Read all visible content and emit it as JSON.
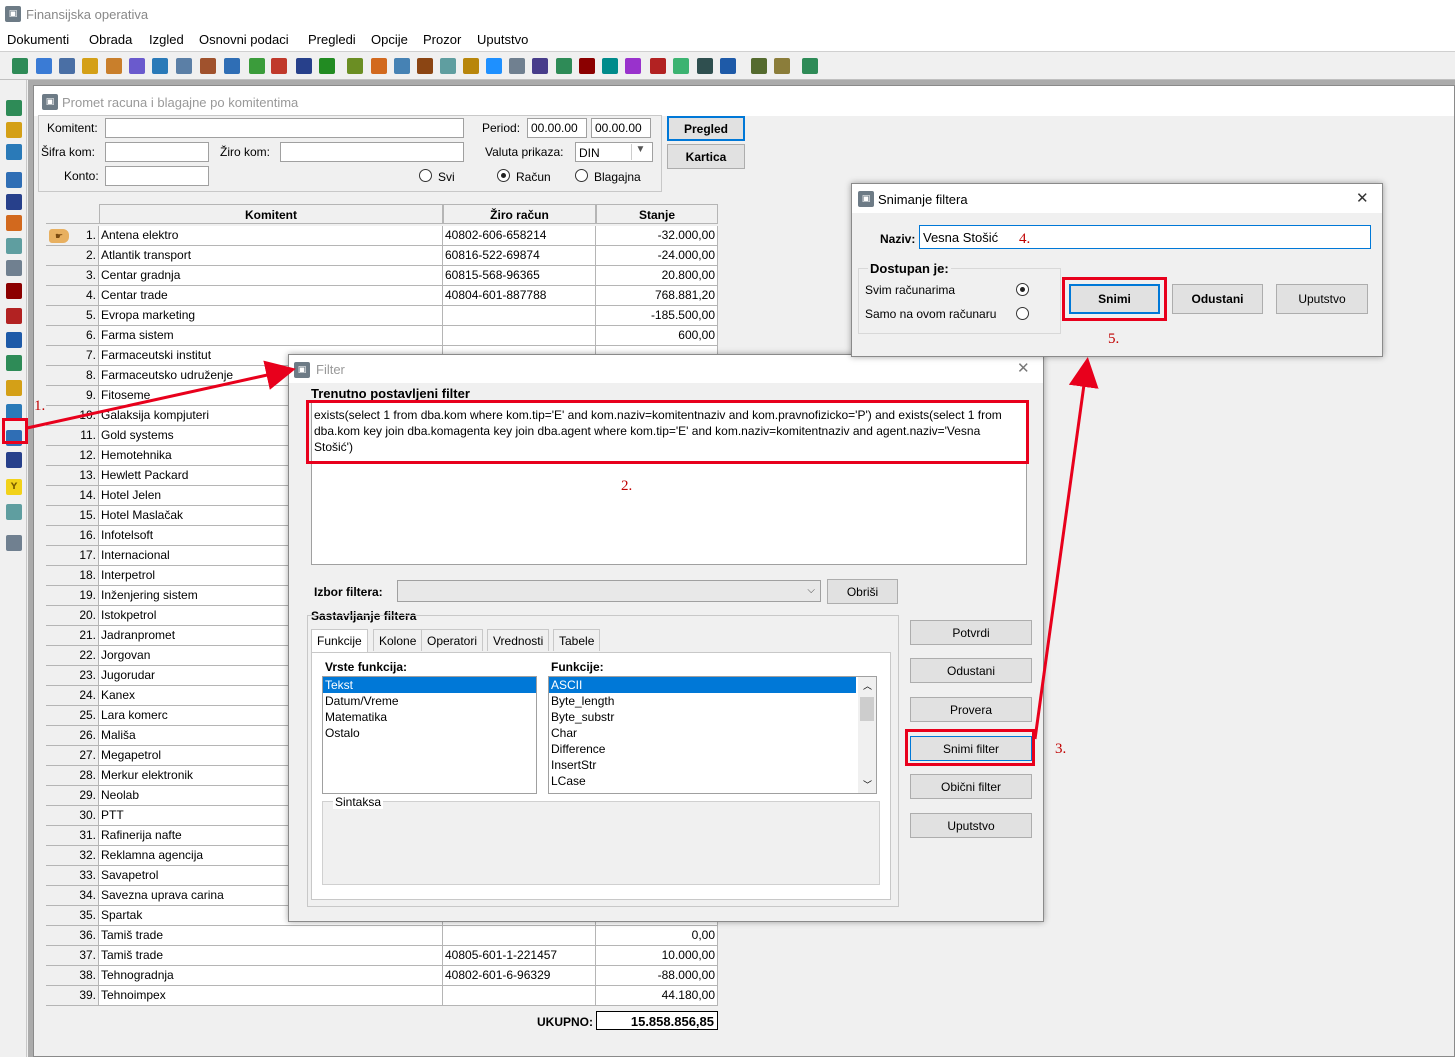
{
  "app": {
    "title": "Finansijska operativa"
  },
  "menu": [
    "Dokumenti",
    "Obrada",
    "Izgled",
    "Osnovni podaci",
    "Pregledi",
    "Opcije",
    "Prozor",
    "Uputstvo"
  ],
  "colors": {
    "annotation": "#e8001c",
    "selection": "#0078d7"
  },
  "child": {
    "title": "Promet racuna i blagajne po komitentima"
  },
  "form": {
    "komitent_label": "Komitent:",
    "sifra_label": "Šifra kom:",
    "ziro_label": "Žiro kom:",
    "konto_label": "Konto:",
    "period_label": "Period:",
    "period_from": "00.00.00",
    "period_to": "00.00.00",
    "valuta_label": "Valuta prikaza:",
    "valuta_value": "DIN",
    "radios": {
      "svi": "Svi",
      "racun": "Račun",
      "blagajna": "Blagajna"
    },
    "pregled": "Pregled",
    "kartica": "Kartica"
  },
  "grid": {
    "headers": [
      "Komitent",
      "Žiro račun",
      "Stanje"
    ],
    "rows": [
      [
        "1.",
        "Antena elektro",
        "40802-606-658214",
        "-32.000,00"
      ],
      [
        "2.",
        "Atlantik transport",
        "60816-522-69874",
        "-24.000,00"
      ],
      [
        "3.",
        "Centar gradnja",
        "60815-568-96365",
        "20.800,00"
      ],
      [
        "4.",
        "Centar trade",
        "40804-601-887788",
        "768.881,20"
      ],
      [
        "5.",
        "Evropa marketing",
        "",
        "-185.500,00"
      ],
      [
        "6.",
        "Farma sistem",
        "",
        "600,00"
      ],
      [
        "7.",
        "Farmaceutski institut",
        "",
        ""
      ],
      [
        "8.",
        "Farmaceutsko udruženje",
        "",
        ""
      ],
      [
        "9.",
        "Fitoseme",
        "",
        ""
      ],
      [
        "10.",
        "Galaksija kompjuteri",
        "",
        ""
      ],
      [
        "11.",
        "Gold systems",
        "",
        ""
      ],
      [
        "12.",
        "Hemotehnika",
        "",
        ""
      ],
      [
        "13.",
        "Hewlett Packard",
        "",
        ""
      ],
      [
        "14.",
        "Hotel Jelen",
        "",
        ""
      ],
      [
        "15.",
        "Hotel Maslačak",
        "",
        ""
      ],
      [
        "16.",
        "Infotelsoft",
        "",
        ""
      ],
      [
        "17.",
        "Internacional",
        "",
        ""
      ],
      [
        "18.",
        "Interpetrol",
        "",
        ""
      ],
      [
        "19.",
        "Inženjering sistem",
        "",
        ""
      ],
      [
        "20.",
        "Istokpetrol",
        "",
        ""
      ],
      [
        "21.",
        "Jadranpromet",
        "",
        ""
      ],
      [
        "22.",
        "Jorgovan",
        "",
        ""
      ],
      [
        "23.",
        "Jugorudar",
        "",
        ""
      ],
      [
        "24.",
        "Kanex",
        "",
        ""
      ],
      [
        "25.",
        "Lara komerc",
        "",
        ""
      ],
      [
        "26.",
        "Mališa",
        "",
        ""
      ],
      [
        "27.",
        "Megapetrol",
        "",
        ""
      ],
      [
        "28.",
        "Merkur elektronik",
        "",
        ""
      ],
      [
        "29.",
        "Neolab",
        "",
        ""
      ],
      [
        "30.",
        "PTT",
        "",
        ""
      ],
      [
        "31.",
        "Rafinerija nafte",
        "",
        ""
      ],
      [
        "32.",
        "Reklamna agencija",
        "",
        ""
      ],
      [
        "33.",
        "Savapetrol",
        "",
        ""
      ],
      [
        "34.",
        "Savezna uprava carina",
        "",
        ""
      ],
      [
        "35.",
        "Spartak",
        "",
        ""
      ],
      [
        "36.",
        "Tamiš trade",
        "",
        "0,00"
      ],
      [
        "37.",
        "Tamiš trade",
        "40805-601-1-221457",
        "10.000,00"
      ],
      [
        "38.",
        "Tehnogradnja",
        "40802-601-6-96329",
        "-88.000,00"
      ],
      [
        "39.",
        "Tehnoimpex",
        "",
        "44.180,00"
      ]
    ],
    "total_label": "UKUPNO:",
    "total_value": "15.858.856,85"
  },
  "filter": {
    "title": "Filter",
    "current_label": "Trenutno postavljeni filter",
    "current_text": "exists(select 1 from dba.kom where kom.tip='E' and kom.naziv=komitentnaziv and kom.pravnofizicko='P') and exists(select 1 from dba.kom key join dba.komagenta key join dba.agent where kom.tip='E' and kom.naziv=komitentnaziv and agent.naziv='Vesna Stošić')",
    "izbor_label": "Izbor filtera:",
    "obrisi": "Obriši",
    "sastavljanje_label": "Sastavljanje filtera",
    "tabs": [
      "Funkcije",
      "Kolone",
      "Operatori",
      "Vrednosti",
      "Tabele"
    ],
    "vrste_label": "Vrste funkcija:",
    "vrste": [
      "Tekst",
      "Datum/Vreme",
      "Matematika",
      "Ostalo"
    ],
    "funkcije_label": "Funkcije:",
    "funkcije": [
      "ASCII",
      "Byte_length",
      "Byte_substr",
      "Char",
      "Difference",
      "InsertStr",
      "LCase"
    ],
    "sintaksa_label": "Sintaksa",
    "buttons": {
      "potvrdi": "Potvrdi",
      "odustani": "Odustani",
      "provera": "Provera",
      "snimi": "Snimi filter",
      "obicni": "Obični filter",
      "uputstvo": "Uputstvo"
    }
  },
  "save": {
    "title": "Snimanje filtera",
    "naziv_label": "Naziv:",
    "naziv_value": "Vesna Stošić",
    "dostupan_label": "Dostupan je:",
    "svim": "Svim računarima",
    "samo": "Samo na ovom računaru",
    "snimi": "Snimi",
    "odustani": "Odustani",
    "uputstvo": "Uputstvo"
  },
  "annotations": [
    "1.",
    "2.",
    "3.",
    "4.",
    "5."
  ]
}
